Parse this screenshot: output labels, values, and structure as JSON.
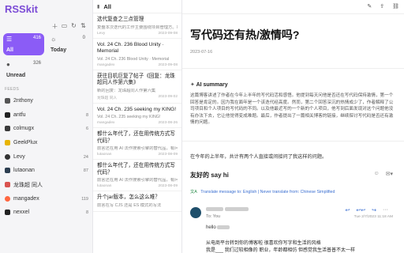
{
  "app": {
    "name": "RSSkit"
  },
  "sidebar": {
    "toolbar_icons": [
      "add-icon",
      "folder-icon",
      "refresh-icon",
      "sync-icon"
    ],
    "cards": [
      {
        "id": "all",
        "label": "All",
        "count": "416",
        "icon": "inbox-icon"
      },
      {
        "id": "today",
        "label": "Today",
        "count": "0",
        "icon": "sun-icon"
      },
      {
        "id": "unread",
        "label": "Unread",
        "count": "326",
        "icon": "circle-icon"
      }
    ],
    "feeds_heading": "FEEDS",
    "feeds": [
      {
        "name": "2nthony",
        "count": "",
        "color": "#555555"
      },
      {
        "name": "antfu",
        "count": "8",
        "color": "#222222"
      },
      {
        "name": "colmugx",
        "count": "6",
        "color": "#3a3a3a"
      },
      {
        "name": "GeekPlux",
        "count": "",
        "color": "#e8b400"
      },
      {
        "name": "Levy",
        "count": "24",
        "color": "#333333"
      },
      {
        "name": "lutaonan",
        "count": "87",
        "color": "#2c3e50"
      },
      {
        "name": "龙珠超 同人",
        "count": "",
        "color": "#d9534f"
      },
      {
        "name": "mangadex",
        "count": "119",
        "color": "#ff6740"
      },
      {
        "name": "nexxel",
        "count": "8",
        "color": "#222222"
      }
    ]
  },
  "list": {
    "header": "All",
    "articles": [
      {
        "title": "选代复查之三点管理",
        "snippet": "复盘本次迭代的工作主要围绕项目管理方。将稀缺注重于Tick 出类的代码评估和复盘",
        "source": "Levy",
        "date": "2023-09-08"
      },
      {
        "title": "Vol. 24 Ch. 236 Blood Unity · Memorial",
        "snippet": "Vol. 24 Ch. 236 Blood Unity · Memorial",
        "source": "mangadex",
        "date": "2023-09-08"
      },
      {
        "title": "获往目机巨复了帖子《回复：龙珠超同人作第六集》",
        "snippet": "新的回复：龙珠超同人作第六集",
        "source": "龙珠超 同人",
        "date": "2023-09-02"
      },
      {
        "title": "Vol. 24 Ch. 235 seeking my KING!",
        "snippet": "Vol. 24 Ch. 235 seeking my KING!",
        "source": "mangadex",
        "date": "2023-08-26"
      },
      {
        "title": "都什么年代了，还在用传统方式写代码？",
        "snippet": "前言还在用 AI 法作搜索引擎的替代品，有问题不问 AI，没问题就是答用搜索引擎",
        "source": "lutaonan",
        "date": "2023-08-09"
      },
      {
        "title": "都什么年代了，还在用传统方式写代码？",
        "snippet": "前言还在用 AI 法作搜索引擎的替代品，有问题不问 AI，没问题就是答用搜索引擎",
        "source": "lutaonan",
        "date": "2023-08-09"
      },
      {
        "title": "升个jar版本，怎么这么难？",
        "snippet": "前言在写 CJS 还是 ES 模式的写法",
        "source": "",
        "date": ""
      }
    ]
  },
  "article": {
    "title": "写代码还有热/激情吗?",
    "date": "2023-07-16",
    "top_icons": [
      "tag-icon",
      "share-icon",
      "link-icon"
    ],
    "ai_heading": "AI summary",
    "ai_body": "这篇博客讲述了作者在今年上半年的写代码活和感悟。他提到每天问他是否还在写代码保持激情，第一个回答是肯定的。因为我在面年是一个该迭代经高度。然而，第二个回答深沉的热情成少了，作者解释了公司项目和个人项目的写代码的不同。以及他最近写的一个新的个人项目，他写到后面发现对这个问题他没有办法下去，它让他觉得变成难题。最后，作者提出了一篇相关博客的链接，继续探讨写代码是否还有激情的问题。",
    "intro": "在今年的上半年，共计有两个人直接或间接问了我这样的问题。",
    "mail": {
      "subject": "友好的 say hi",
      "translate_prefix": "Translate message to: English",
      "translate_never": "Never translate from: Chinese Simplified",
      "to": "To: You",
      "date": "Tue 2/7/2023 11:18 AM",
      "hello": "hello",
      "line1": "从电商平台转到你的博客啦 很喜欢你写字和生活的风格",
      "line2": "我是___ 我们过较相像的 职业，年龄都相仿 但感觉我生活普普不太一样"
    }
  }
}
